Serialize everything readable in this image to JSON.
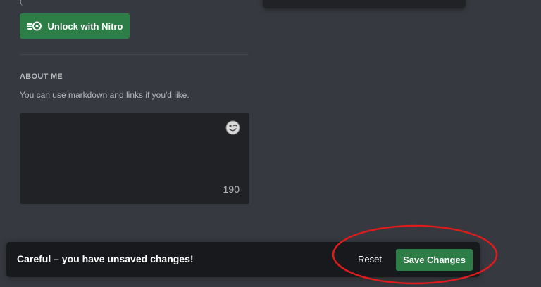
{
  "profile": {
    "nitro_button_label": "Unlock with Nitro",
    "stray_text": "(",
    "about_me": {
      "title": "ABOUT ME",
      "description": "You can use markdown and links if you'd like.",
      "value": "",
      "char_remaining": "190"
    }
  },
  "unsaved_bar": {
    "message": "Careful – you have unsaved changes!",
    "reset_label": "Reset",
    "save_label": "Save Changes"
  },
  "colors": {
    "background": "#36393f",
    "input_bg": "#202225",
    "bar_bg": "#18191c",
    "accent_green": "#2d7d46",
    "annotation_red": "#e01b1b"
  },
  "icons": {
    "nitro": "nitro-icon",
    "emoji": "emoji-icon"
  }
}
